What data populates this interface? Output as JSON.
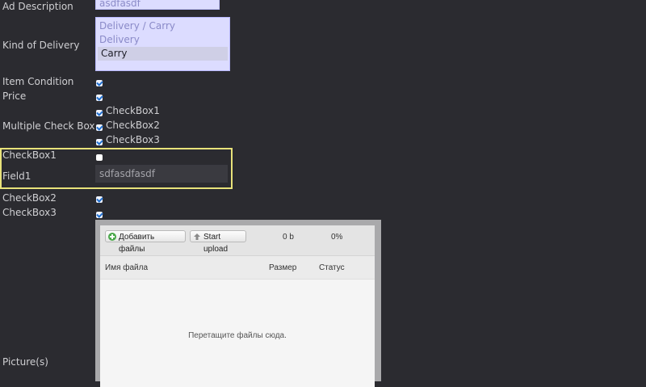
{
  "form": {
    "ad_description": {
      "label": "Ad Description",
      "value": "asdfasdf"
    },
    "kind_of_delivery": {
      "label": "Kind of Delivery",
      "options": [
        "Delivery / Carry",
        "Delivery",
        "Carry"
      ],
      "selected": "Carry"
    },
    "item_condition": {
      "label": "Item Condition",
      "checked": true
    },
    "price": {
      "label": "Price",
      "checked": true
    },
    "multiple_check_box": {
      "label": "Multiple Check Box",
      "items": [
        {
          "label": "CheckBox1",
          "checked": true
        },
        {
          "label": "CheckBox2",
          "checked": true
        },
        {
          "label": "CheckBox3",
          "checked": true
        }
      ]
    },
    "checkbox1": {
      "label": "CheckBox1",
      "checked": false
    },
    "field1": {
      "label": "Field1",
      "value": "sdfasdfasdf"
    },
    "checkbox2": {
      "label": "CheckBox2",
      "checked": true
    },
    "checkbox3": {
      "label": "CheckBox3",
      "checked": true
    },
    "pictures": {
      "label": "Picture(s)"
    }
  },
  "uploader": {
    "add_files_label": "Добавить файлы",
    "start_upload_label": "Start upload",
    "total_size": "0 b",
    "total_percent": "0%",
    "col_filename": "Имя файла",
    "col_size": "Размер",
    "col_status": "Статус",
    "drop_text": "Перетащите файлы сюда."
  },
  "colors": {
    "background": "#2b2b30",
    "highlight_border": "#e8e27a",
    "input_bg": "#dcdcff"
  }
}
